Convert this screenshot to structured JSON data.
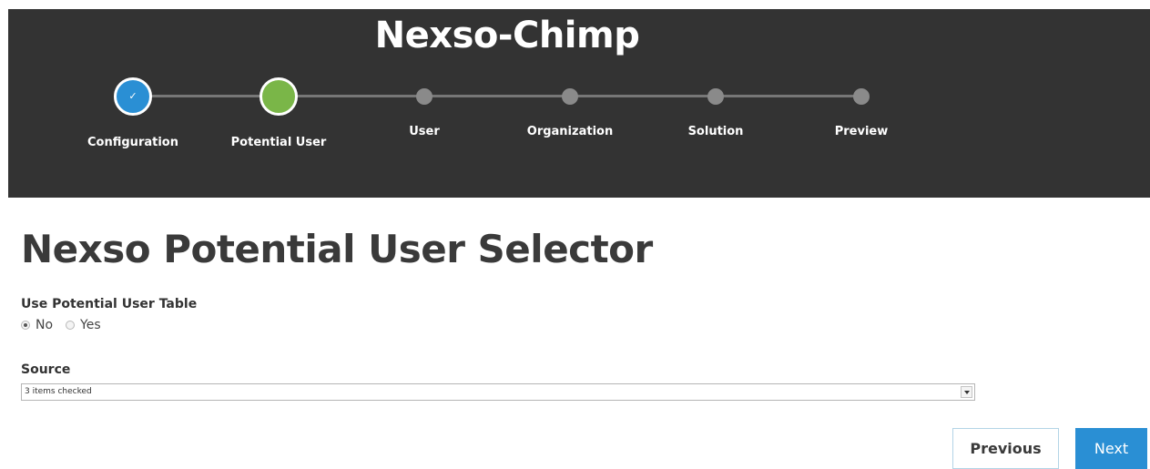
{
  "header": {
    "title": "Nexso-Chimp"
  },
  "wizard": {
    "steps": [
      {
        "label": "Configuration",
        "state": "done",
        "icon": "check-icon",
        "check": "✓"
      },
      {
        "label": "Potential User",
        "state": "current"
      },
      {
        "label": "User",
        "state": "future"
      },
      {
        "label": "Organization",
        "state": "future"
      },
      {
        "label": "Solution",
        "state": "future"
      },
      {
        "label": "Preview",
        "state": "future"
      }
    ]
  },
  "main": {
    "title": "Nexso Potential User Selector",
    "use_table": {
      "label": "Use Potential User Table",
      "options": [
        {
          "label": "No",
          "checked": true
        },
        {
          "label": "Yes",
          "checked": false
        }
      ]
    },
    "source": {
      "label": "Source",
      "value": "3 items checked",
      "icon": "dropdown-arrow-icon"
    }
  },
  "footer": {
    "previous_label": "Previous",
    "next_label": "Next"
  },
  "colors": {
    "header_bg": "#333333",
    "done_step": "#2a8fd4",
    "current_step": "#7ab648",
    "future_step": "#8a8a8a",
    "next_button": "#2a8fd4"
  }
}
